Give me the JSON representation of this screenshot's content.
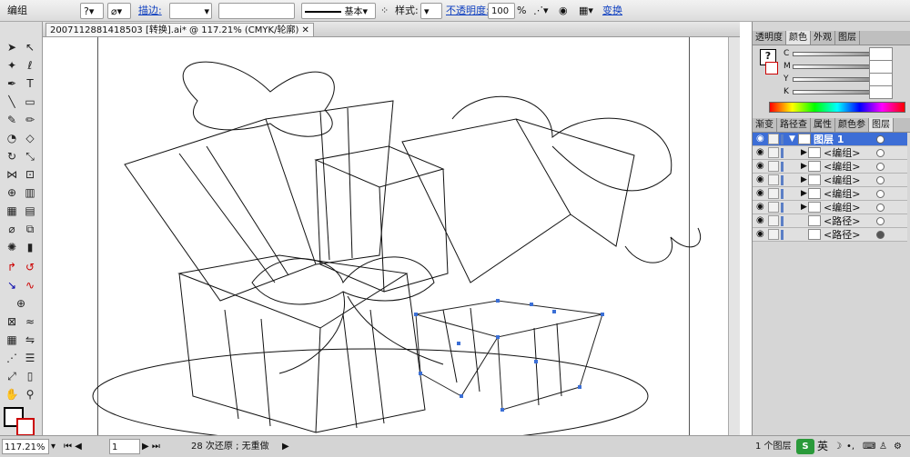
{
  "control_bar": {
    "selection_label": "编组",
    "stroke_label": "描边:",
    "stroke_weight": "",
    "brush_label": "基本",
    "style_label": "样式:",
    "opacity_label": "不透明度:",
    "opacity_value": "100",
    "opacity_unit": "%",
    "transform_label": "变换"
  },
  "document": {
    "tab_title": "2007112881418503 [转换].ai* @ 117.21% (CMYK/轮廓)"
  },
  "color_panel": {
    "tabs": [
      "透明度",
      "颜色",
      "外观",
      "图层"
    ],
    "channels": [
      "C",
      "M",
      "Y",
      "K"
    ]
  },
  "layers_panel": {
    "tabs": [
      "渐变",
      "路径查",
      "属性",
      "颜色参",
      "图层"
    ],
    "rows": [
      {
        "name": "图层 1",
        "expanded": true
      },
      {
        "name": "<编组>",
        "expanded": false
      },
      {
        "name": "<编组>",
        "expanded": false
      },
      {
        "name": "<编组>",
        "expanded": false
      },
      {
        "name": "<编组>",
        "expanded": false
      },
      {
        "name": "<编组>",
        "expanded": false
      },
      {
        "name": "<路径>",
        "expanded": false
      },
      {
        "name": "<路径>",
        "expanded": false
      }
    ],
    "footer": "1 个图层"
  },
  "status_bar": {
    "zoom": "117.21%",
    "page": "1",
    "undo_info": "28 次还原 ; 无重做"
  },
  "taskbar": {
    "ime_label": "英"
  }
}
